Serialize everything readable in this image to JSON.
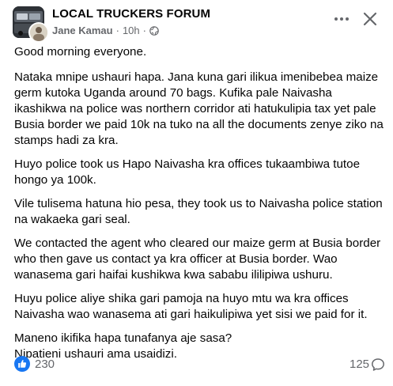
{
  "header": {
    "group_name": "LOCAL TRUCKERS FORUM",
    "author": "Jane Kamau",
    "separator": "·",
    "time": "10h",
    "separator2": "·",
    "audience_icon": "globe-icon",
    "more_icon": "more-options-icon",
    "close_icon": "close-icon"
  },
  "post": {
    "paragraphs": [
      "Good morning everyone.",
      "Nataka mnipe ushauri hapa. Jana kuna gari ilikua imenibebea maize germ kutoka Uganda around 70 bags. Kufika pale Naivasha ikashikwa na police was northern corridor ati hatukulipia tax yet pale Busia border we paid 10k na tuko na all the documents zenye ziko na stamps hadi za kra.",
      "Huyo police took us Hapo Naivasha kra offices tukaambiwa tutoe hongo ya 100k.",
      "Vile tulisema hatuna hio pesa, they took us to Naivasha police station na wakaeka gari seal.",
      "We contacted the agent who cleared our maize germ at Busia border who then gave us contact ya kra officer at Busia border. Wao wanasema gari haifai kushikwa kwa sababu ililipiwa ushuru.",
      "Huyu police aliye shika gari pamoja na huyo mtu wa kra offices Naivasha wao wanasema ati gari haikulipiwa yet sisi we paid for it.",
      "Maneno ikifika hapa tunafanya aje sasa?\nNipatieni ushauri ama usaidizi."
    ]
  },
  "footer": {
    "like_icon": "like-reaction-icon",
    "like_count": "230",
    "comment_count": "125",
    "comment_icon": "comment-icon"
  },
  "colors": {
    "like_blue": "#1877f2",
    "meta_gray": "#65676b",
    "text": "#050505"
  }
}
